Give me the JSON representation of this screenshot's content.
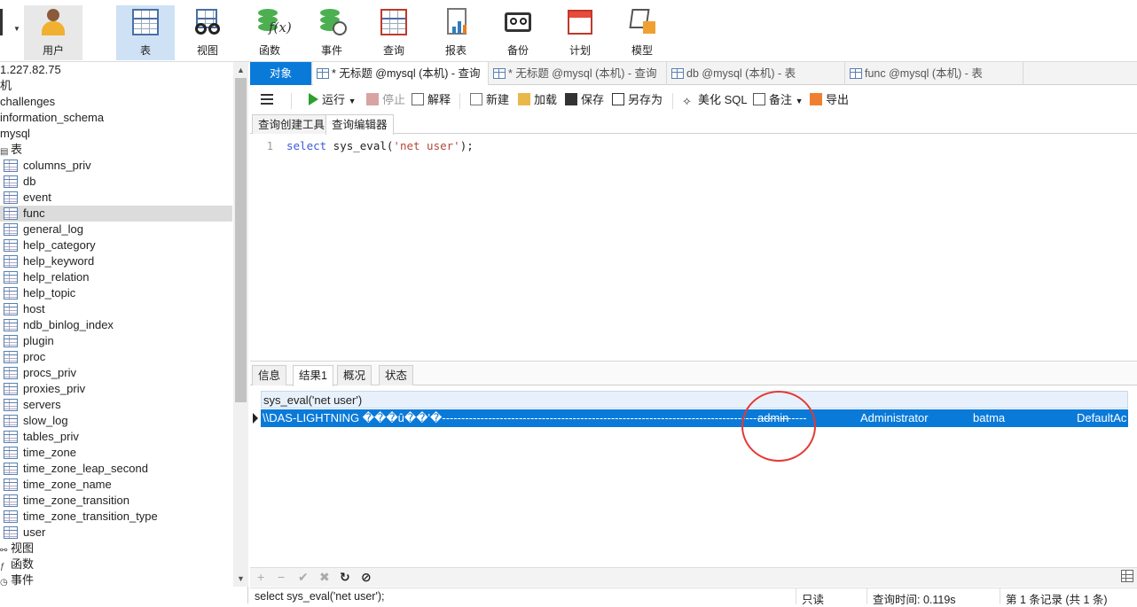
{
  "ribbon": {
    "user": "用户",
    "table": "表",
    "view": "视图",
    "function": "函数",
    "event": "事件",
    "query": "查询",
    "report": "报表",
    "backup": "备份",
    "schedule": "计划",
    "model": "模型"
  },
  "tree": {
    "connection": "1.227.82.75",
    "db_jiu": "机",
    "db_challenges": "challenges",
    "db_information_schema": "information_schema",
    "db_mysql": "mysql",
    "tables_node": "表",
    "tables": [
      "columns_priv",
      "db",
      "event",
      "func",
      "general_log",
      "help_category",
      "help_keyword",
      "help_relation",
      "help_topic",
      "host",
      "ndb_binlog_index",
      "plugin",
      "proc",
      "procs_priv",
      "proxies_priv",
      "servers",
      "slow_log",
      "tables_priv",
      "time_zone",
      "time_zone_leap_second",
      "time_zone_name",
      "time_zone_transition",
      "time_zone_transition_type",
      "user"
    ],
    "selected_table": "func",
    "views_node": "视图",
    "functions_node": "函数",
    "events_node": "事件"
  },
  "tabs": [
    {
      "label": "对象"
    },
    {
      "label": "* 无标题 @mysql (本机) - 查询"
    },
    {
      "label": "* 无标题 @mysql (本机) - 查询"
    },
    {
      "label": "db @mysql (本机) - 表"
    },
    {
      "label": "func @mysql (本机) - 表"
    }
  ],
  "toolbar": {
    "run": "运行",
    "stop": "停止",
    "explain": "解释",
    "new": "新建",
    "load": "加载",
    "save": "保存",
    "save_as": "另存为",
    "beautify": "美化 SQL",
    "comment": "备注",
    "export": "导出"
  },
  "subtabs": {
    "builder": "查询创建工具",
    "editor": "查询编辑器"
  },
  "editor": {
    "line_number": "1",
    "code_kw": "select",
    "code_fn": " sys_eval(",
    "code_str": "'net user'",
    "code_end": ");"
  },
  "result_tabs": {
    "info": "信息",
    "result1": "结果1",
    "profile": "概况",
    "status": "状态"
  },
  "grid": {
    "column": "sys_eval('net user')",
    "row_text": "\\\\DAS-LIGHTNING ���û��'�-----------------------------------------------------------------------------------------------",
    "cell_admin": "admin",
    "cell_administrator": "Administrator",
    "cell_batma": "batma",
    "cell_default": "DefaultAc"
  },
  "gridnav": {
    "add": "+",
    "remove": "−",
    "apply": "✔",
    "discard": "✖",
    "refresh": "↻",
    "stop": "⊘"
  },
  "statusbar": {
    "sql": "select sys_eval('net user');",
    "readonly": "只读",
    "query_time": "查询时间: 0.119s",
    "records": "第 1 条记录 (共 1 条)"
  },
  "colors": {
    "accent": "#0a7ad9",
    "selection": "#0a7ad9",
    "annotation_circle": "#e53935"
  }
}
